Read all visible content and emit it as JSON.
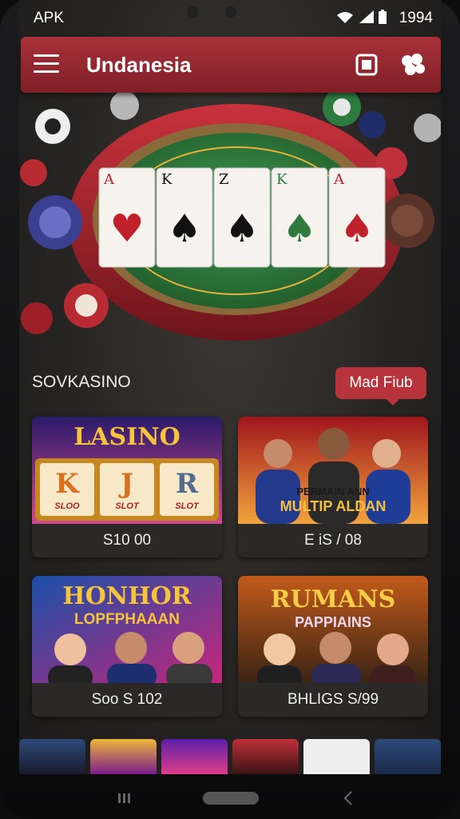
{
  "status_bar": {
    "carrier": "APK",
    "time": "1994"
  },
  "header": {
    "title": "Undanesia",
    "menu_icon": "hamburger-menu-icon",
    "action_icon_1": "wallet-icon",
    "action_icon_2": "gamepad-icon"
  },
  "hero": {
    "cards": [
      "A",
      "K",
      "Z",
      "K",
      "A"
    ],
    "suits": [
      "hearts",
      "spades",
      "spades",
      "spades",
      "spades"
    ]
  },
  "section": {
    "title": "SOVKASINO",
    "action_label": "Mad Fiub"
  },
  "games": [
    {
      "title": "LASINO",
      "reels": [
        "K",
        "J",
        "R"
      ],
      "reel_sub": [
        "SLOO",
        "SLOT",
        "SLOT"
      ],
      "caption": "S10 00"
    },
    {
      "title": "PERMAIN ANN",
      "subtitle": "MULTIP ALDAN",
      "caption": "E iS / 08"
    },
    {
      "title": "HONHOR",
      "subtitle": "LOPFPHAAAN",
      "caption": "Soo S 102"
    },
    {
      "title": "RUMANS",
      "subtitle": "PAPPIAINS",
      "caption": "BHLIGS S/99"
    }
  ],
  "colors": {
    "accent": "#a8313a",
    "felt": "#2f7a3c",
    "gold": "#e8b23a"
  }
}
